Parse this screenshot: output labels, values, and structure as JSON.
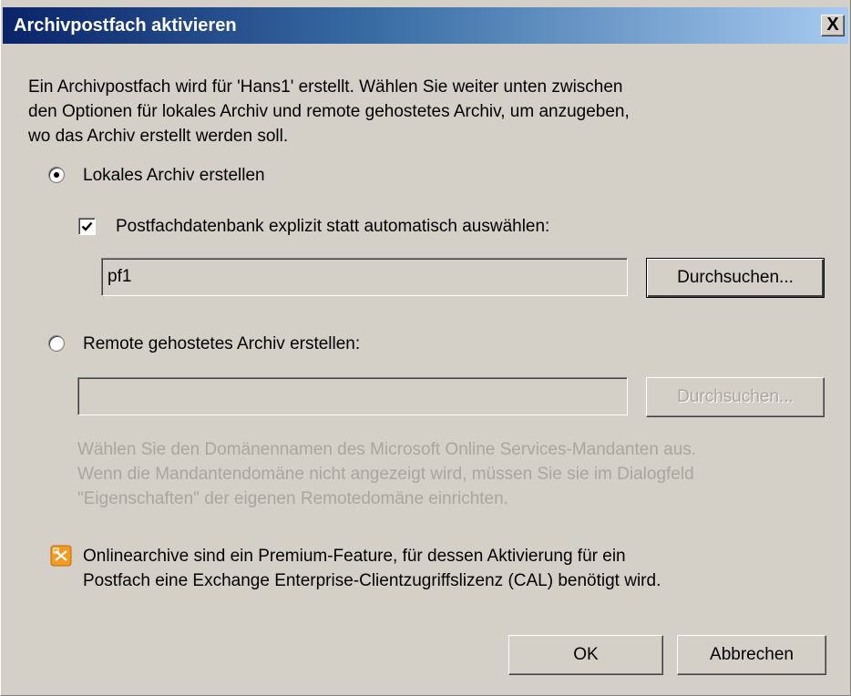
{
  "window": {
    "title": "Archivpostfach aktivieren",
    "close_glyph": "X"
  },
  "intro_lines": [
    "Ein Archivpostfach wird für 'Hans1' erstellt. Wählen Sie weiter unten zwischen",
    "den Optionen für lokales Archiv und remote gehostetes Archiv, um anzugeben,",
    "wo das Archiv erstellt werden soll."
  ],
  "local_archive": {
    "label": "Lokales Archiv erstellen",
    "selected": true,
    "explicit_db": {
      "label": "Postfachdatenbank explizit statt automatisch auswählen:",
      "checked": true
    },
    "db_value": "pf1",
    "browse_label": "Durchsuchen..."
  },
  "remote_archive": {
    "label": "Remote gehostetes Archiv erstellen:",
    "selected": false,
    "domain_value": "",
    "browse_label": "Durchsuchen...",
    "hint_lines": [
      "Wählen Sie den Domänennamen des Microsoft Online Services-Mandanten aus.",
      "Wenn die Mandantendomäne nicht angezeigt wird, müssen Sie sie im Dialogfeld",
      "\"Eigenschaften\" der eigenen Remotedomäne einrichten."
    ]
  },
  "premium_note": {
    "icon": "exchange-warning-icon",
    "lines": [
      "Onlinearchive sind ein Premium-Feature, für dessen Aktivierung für ein",
      "Postfach eine Exchange Enterprise-Clientzugriffslizenz (CAL) benötigt wird."
    ]
  },
  "buttons": {
    "ok": "OK",
    "cancel": "Abbrechen"
  },
  "colors": {
    "dialog_bg": "#d4d0c8",
    "title_start": "#0a246a",
    "title_end": "#a6caf0",
    "disabled_text": "#a9a69f",
    "icon_orange": "#f29a21"
  }
}
